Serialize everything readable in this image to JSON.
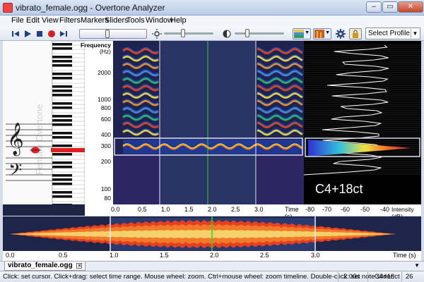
{
  "window": {
    "title": "vibrato_female.ogg - Overtone Analyzer",
    "controls": [
      "–",
      "▭",
      "✕"
    ]
  },
  "menu": [
    "File",
    "Edit",
    "View",
    "Filters",
    "Markers",
    "Sliders",
    "Tools",
    "Window",
    "Help"
  ],
  "toolbar": {
    "profile": "Select Profile"
  },
  "freq_axis": {
    "title": "Frequency",
    "unit": "(Hz)",
    "ticks": [
      "2000",
      "1000",
      "800",
      "600",
      "400",
      "300",
      "200",
      "100",
      "80"
    ]
  },
  "piano": {
    "watermark": "Female Overtone"
  },
  "spectrogram": {
    "time_ticks": [
      "0.0",
      "0.5",
      "1.0",
      "1.5",
      "2.0",
      "2.5",
      "3.0"
    ],
    "time_unit": "Time (s)"
  },
  "harmonics": {
    "note": "C4+18ct",
    "intensity_ticks": [
      "-80",
      "-70",
      "-60",
      "-50",
      "-40"
    ],
    "intensity_unit": "Intensity (dB)"
  },
  "overview": {
    "time_ticks": [
      "0.0",
      "0.5",
      "1.0",
      "1.5",
      "2.0",
      "2.5",
      "3.0"
    ],
    "time_unit": "Time (s)"
  },
  "tab": {
    "file": "vibrato_female.ogg"
  },
  "status": {
    "hint": "Click: set cursor. Click+drag: select time range. Mouse wheel: zoom. Ctrl+mouse wheel: zoom timeline. Double-click: set note slider.",
    "time": "2.00s",
    "note": "C4+18ct",
    "number": "26"
  },
  "colors": {
    "accent": "#3a5fa8",
    "marker": "#e02020",
    "spectrogram_bg": "#1a2048",
    "selection": "#3a4a7c",
    "cursor": "#33cc33"
  }
}
